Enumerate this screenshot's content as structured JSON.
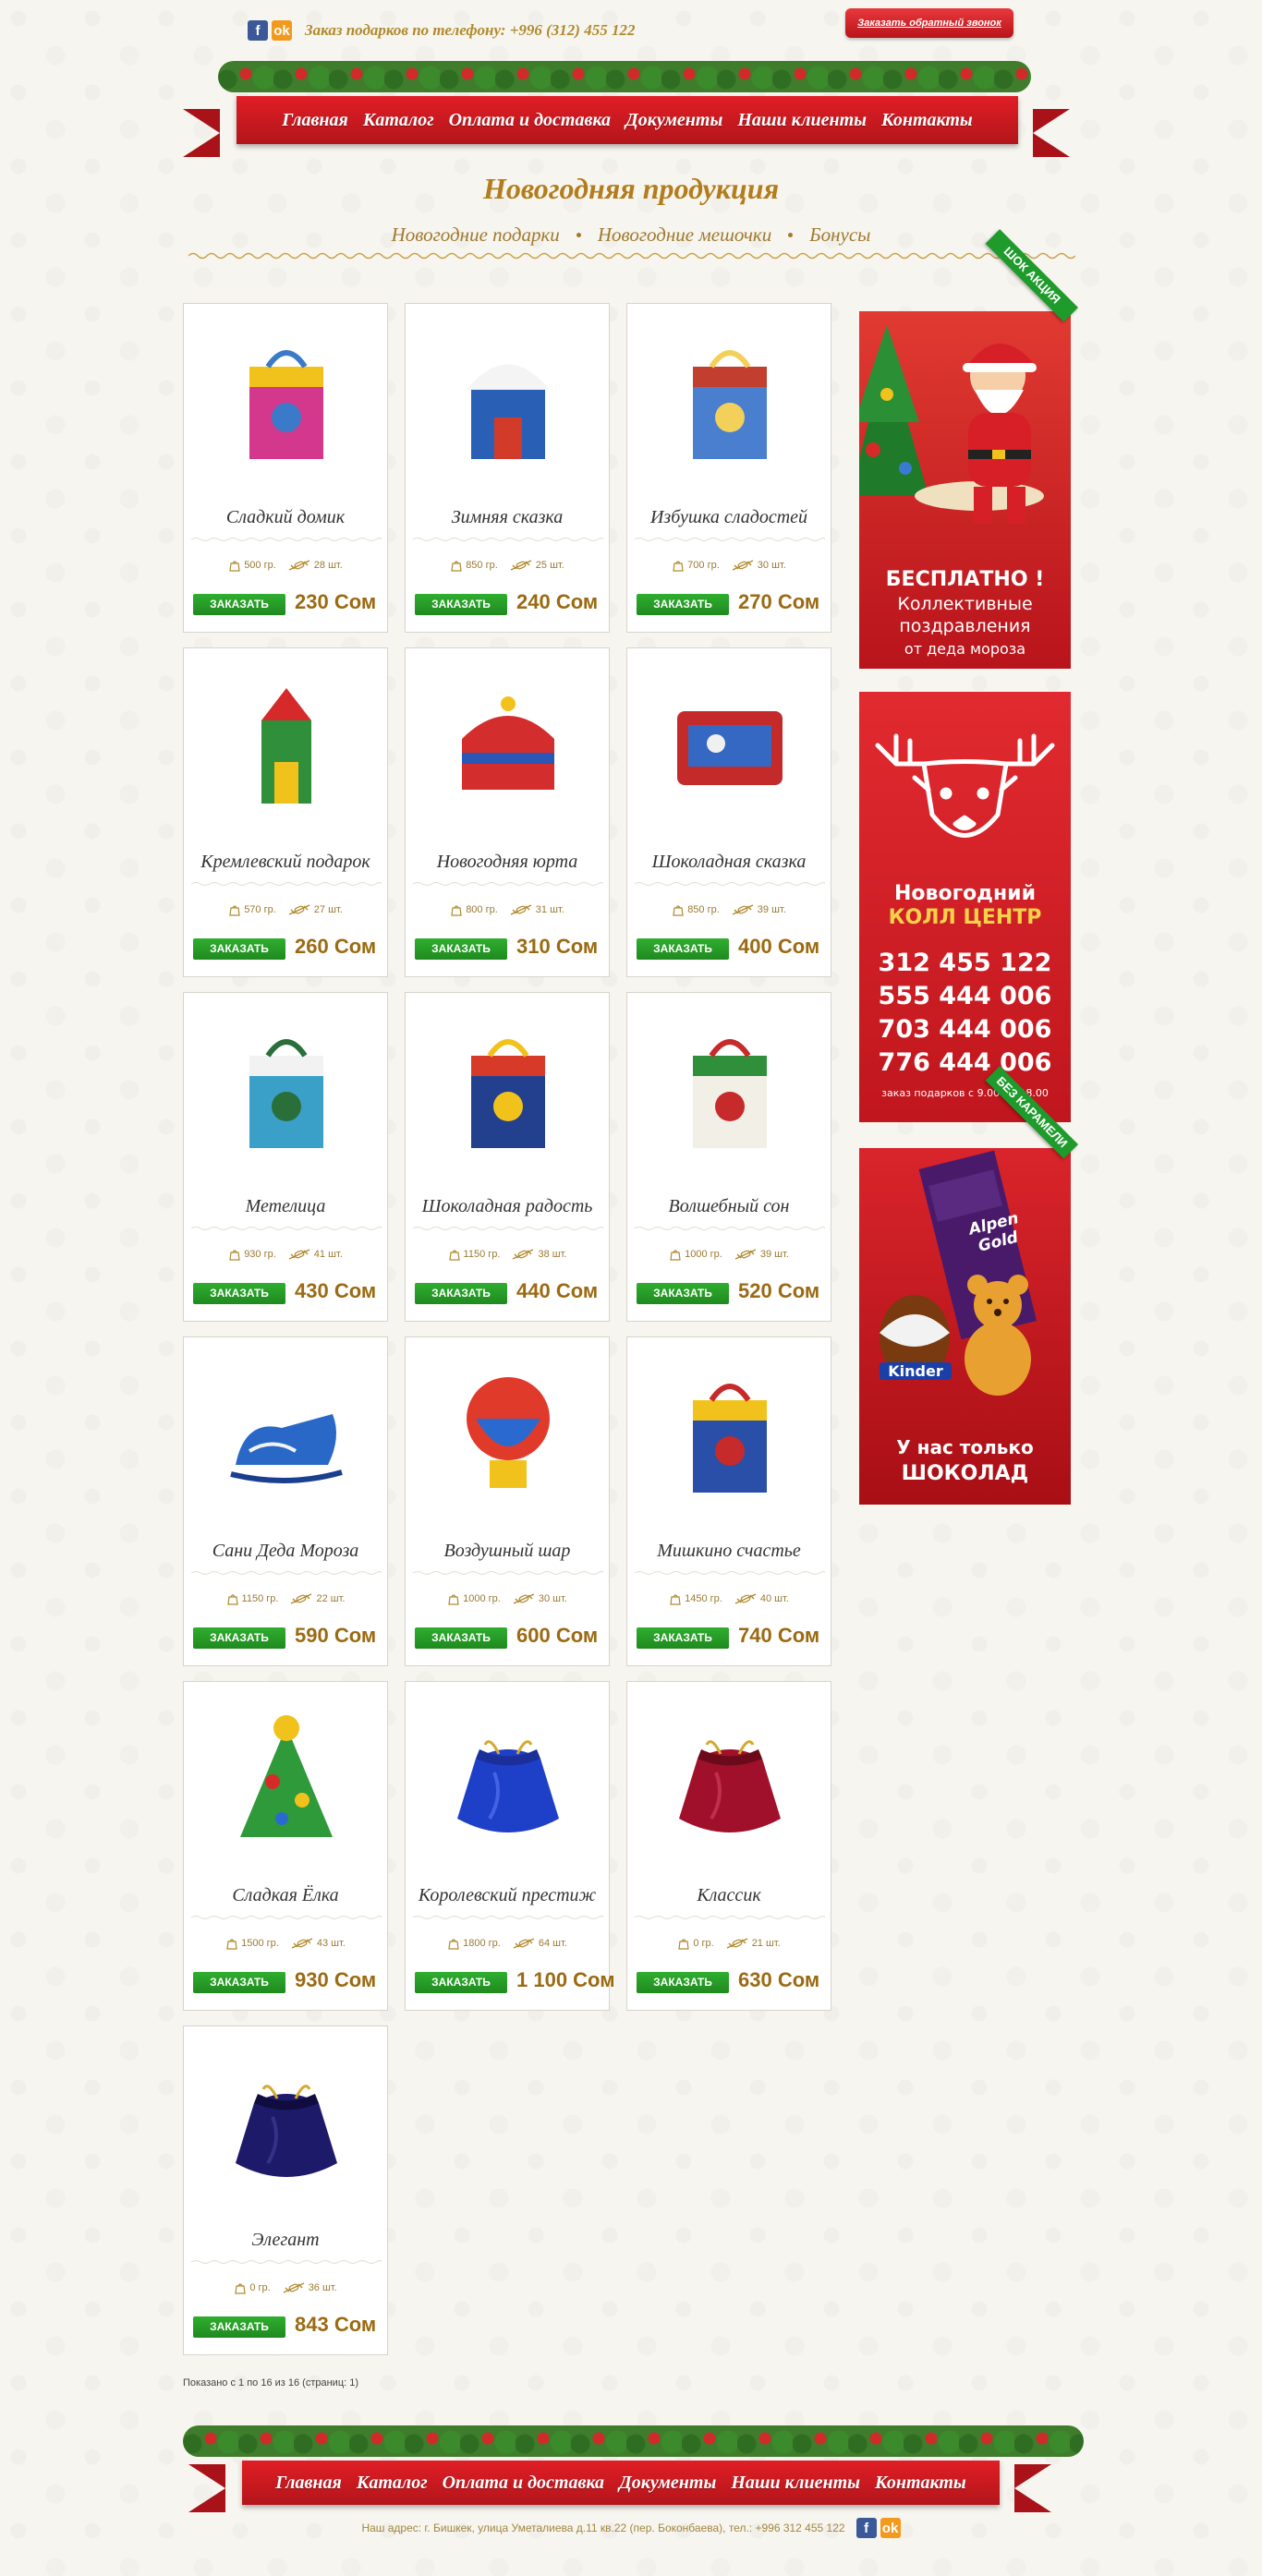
{
  "header": {
    "phone_order": "Заказ подарков по телефону: +996 (312) 455 122",
    "callback_button": "Заказать обратный звонок",
    "social": [
      "f",
      "ok"
    ]
  },
  "nav": [
    "Главная",
    "Каталог",
    "Оплата и доставка",
    "Документы",
    "Наши клиенты",
    "Контакты"
  ],
  "page_title": "Новогодняя продукция",
  "subnav": [
    "Новогодние подарки",
    "Новогодние мешочки",
    "Бонусы"
  ],
  "order_label": "ЗАКАЗАТЬ",
  "products": [
    {
      "name": "Сладкий домик",
      "weight": "500 гр.",
      "count": "28 шт.",
      "price": "230 Сом",
      "shape": "box",
      "colors": [
        "#d4388c",
        "#f2c21c",
        "#3a7ac8"
      ]
    },
    {
      "name": "Зимняя сказка",
      "weight": "850 гр.",
      "count": "25 шт.",
      "price": "240 Сом",
      "shape": "house",
      "colors": [
        "#2a5fb6",
        "#f4f4f4",
        "#d23a2a"
      ]
    },
    {
      "name": "Избушка сладостей",
      "weight": "700 гр.",
      "count": "30 шт.",
      "price": "270 Сом",
      "shape": "box",
      "colors": [
        "#4a7fd0",
        "#c23e2e",
        "#f2d05a"
      ]
    },
    {
      "name": "Кремлевский подарок",
      "weight": "570 гр.",
      "count": "27 шт.",
      "price": "260 Сом",
      "shape": "tower",
      "colors": [
        "#2f8f3a",
        "#d62a2a",
        "#f2c21c"
      ]
    },
    {
      "name": "Новогодняя юрта",
      "weight": "800 гр.",
      "count": "31 шт.",
      "price": "310 Сом",
      "shape": "yurt",
      "colors": [
        "#d42d2d",
        "#2a56b5",
        "#f2c21c"
      ]
    },
    {
      "name": "Шоколадная сказка",
      "weight": "850 гр.",
      "count": "39 шт.",
      "price": "400 Сом",
      "shape": "bag",
      "colors": [
        "#c52a2a",
        "#3468c2",
        "#f0f0f0"
      ]
    },
    {
      "name": "Метелица",
      "weight": "930 гр.",
      "count": "41 шт.",
      "price": "430 Сом",
      "shape": "box",
      "colors": [
        "#3aa0c8",
        "#f2f2f2",
        "#2a6f3a"
      ]
    },
    {
      "name": "Шоколадная радость",
      "weight": "1150 гр.",
      "count": "38 шт.",
      "price": "440 Сом",
      "shape": "box",
      "colors": [
        "#23408f",
        "#d83a2a",
        "#f2c21c"
      ]
    },
    {
      "name": "Волшебный сон",
      "weight": "1000 гр.",
      "count": "39 шт.",
      "price": "520 Сом",
      "shape": "box",
      "colors": [
        "#f2efe6",
        "#2f8f3a",
        "#c62a2a"
      ]
    },
    {
      "name": "Сани Деда Мороза",
      "weight": "1150 гр.",
      "count": "22 шт.",
      "price": "590 Сом",
      "shape": "sleigh",
      "colors": [
        "#2a68c8",
        "#f2f2f2",
        "#1a3f8f"
      ]
    },
    {
      "name": "Воздушный шар",
      "weight": "1000 гр.",
      "count": "30 шт.",
      "price": "600 Сом",
      "shape": "balloon",
      "colors": [
        "#e03a2a",
        "#2a6ad0",
        "#f2c21c"
      ]
    },
    {
      "name": "Мишкино счастье",
      "weight": "1450 гр.",
      "count": "40 шт.",
      "price": "740 Сом",
      "shape": "box",
      "colors": [
        "#2a4fa8",
        "#f2c21c",
        "#c62a2a"
      ]
    },
    {
      "name": "Сладкая Ёлка",
      "weight": "1500 гр.",
      "count": "43 шт.",
      "price": "930 Сом",
      "shape": "tree",
      "colors": [
        "#2f9a3a",
        "#f2c21c",
        "#d62a2a"
      ]
    },
    {
      "name": "Королевский престиж",
      "weight": "1800 гр.",
      "count": "64 шт.",
      "price": "1 100 Сом",
      "shape": "pouch",
      "colors": [
        "#1e3fc8",
        "#1a2f9a",
        "#6a86ff"
      ]
    },
    {
      "name": "Классик",
      "weight": "0 гр.",
      "count": "21 шт.",
      "price": "630 Сом",
      "shape": "pouch",
      "colors": [
        "#a0102a",
        "#6a0a1a",
        "#e05070"
      ]
    },
    {
      "name": "Элегант",
      "weight": "0 гр.",
      "count": "36 шт.",
      "price": "843 Сом",
      "shape": "pouch",
      "colors": [
        "#1e1a6a",
        "#100c40",
        "#4a4aa0"
      ]
    }
  ],
  "pager": "Показано с 1 по 16 из 16 (страниц: 1)",
  "banners": {
    "promo": {
      "corner": "ШОК АКЦИЯ",
      "lines": [
        "БЕСПЛАТНО !",
        "Коллективные",
        "поздравления",
        "от деда мороза"
      ]
    },
    "callcenter": {
      "title1": "Новогодний",
      "title2": "КОЛЛ ЦЕНТР",
      "phones": [
        "312 455 122",
        "555 444 006",
        "703 444 006",
        "776 444 006"
      ],
      "hours": "заказ подарков с 9.00 до 18.00"
    },
    "chocolate": {
      "corner": "БЕЗ КАРАМЕЛИ",
      "brand1": "Alpen Gold",
      "brand2": "Kinder",
      "lines": [
        "У нас только",
        "ШОКОЛАД"
      ]
    }
  },
  "footer": {
    "address": "Наш адрес: г. Бишкек, улица Уметалиева д.11 кв.22 (пер. Боконбаева), тел.: +996 312 455 122"
  },
  "colors": {
    "accent_red": "#d61f26",
    "gold": "#b37d1d",
    "green_btn": "#1f8a1f"
  }
}
